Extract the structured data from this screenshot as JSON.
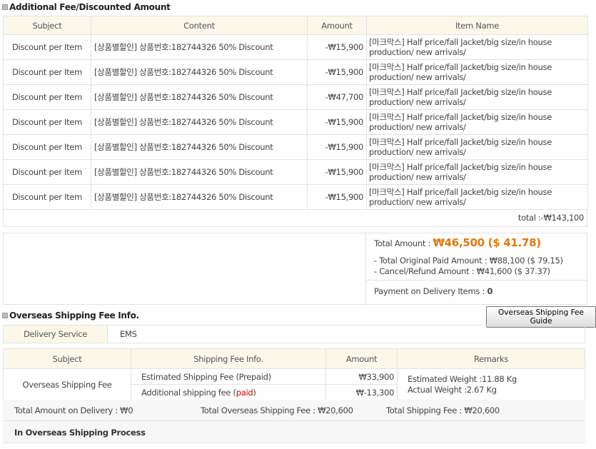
{
  "discount_section": {
    "title": "Additional Fee/Discounted Amount",
    "headers": [
      "Subject",
      "Content",
      "Amount",
      "Item Name"
    ],
    "rows": [
      {
        "subject": "Discount per Item",
        "content": "[상품별할인] 상품번호:182744326 50% Discount",
        "amount": "-₩15,900",
        "item": "[마크막스] Half price/fall Jacket/big size/in house production/ new arrivals/"
      },
      {
        "subject": "Discount per Item",
        "content": "[상품별할인] 상품번호:182744326 50% Discount",
        "amount": "-₩15,900",
        "item": "[마크막스] Half price/fall Jacket/big size/in house production/ new arrivals/"
      },
      {
        "subject": "Discount per Item",
        "content": "[상품별할인] 상품번호:182744326 50% Discount",
        "amount": "-₩47,700",
        "item": "[마크막스] Half price/fall Jacket/big size/in house production/ new arrivals/"
      },
      {
        "subject": "Discount per Item",
        "content": "[상품별할인] 상품번호:182744326 50% Discount",
        "amount": "-₩15,900",
        "item": "[마크막스] Half price/fall Jacket/big size/in house production/ new arrivals/"
      },
      {
        "subject": "Discount per Item",
        "content": "[상품별할인] 상품번호:182744326 50% Discount",
        "amount": "-₩15,900",
        "item": "[마크막스] Half price/fall Jacket/big size/in house production/ new arrivals/"
      },
      {
        "subject": "Discount per Item",
        "content": "[상품별할인] 상품번호:182744326 50% Discount",
        "amount": "-₩15,900",
        "item": "[마크막스] Half price/fall Jacket/big size/in house production/ new arrivals/"
      },
      {
        "subject": "Discount per Item",
        "content": "[상품별할인] 상품번호:182744326 50% Discount",
        "amount": "-₩15,900",
        "item": "[마크막스] Half price/fall Jacket/big size/in house production/ new arrivals/"
      }
    ],
    "total": "total :-₩143,100"
  },
  "summary": {
    "total_label": "Total Amount : ",
    "total_value": "₩46,500 ($ 41.78)",
    "original_paid": "- Total Original Paid Amount : ₩88,100 ($ 79.15)",
    "cancel_refund": "- Cancel/Refund Amount : ₩41,600 ($ 37.37)",
    "pod_label": "Payment on Delivery Items : ",
    "pod_value": "0"
  },
  "shipping_section": {
    "title": "Overseas Shipping Fee Info.",
    "guide_button": "Overseas Shipping Fee Guide",
    "delivery_label": "Delivery Service",
    "delivery_value": "EMS",
    "headers": [
      "Subject",
      "Shipping Fee Info.",
      "Amount",
      "Remarks"
    ],
    "subject": "Overseas Shipping Fee",
    "fee1_label": "Estimated Shipping Fee (Prepaid)",
    "fee1_amount": "₩33,900",
    "fee2_label": "Additional shipping fee (",
    "fee2_paid": "paid",
    "fee2_close": ")",
    "fee2_amount": "₩-13,300",
    "remark1": "Estimated Weight :11.88 Kg",
    "remark2": "Actual Weight :2.67 Kg",
    "total_delivery": "Total Amount on Delivery : ₩0",
    "total_overseas": "Total Overseas Shipping Fee : ₩20,600",
    "total_shipping": "Total Shipping Fee : ₩20,600",
    "status": "In Overseas Shipping Process"
  }
}
